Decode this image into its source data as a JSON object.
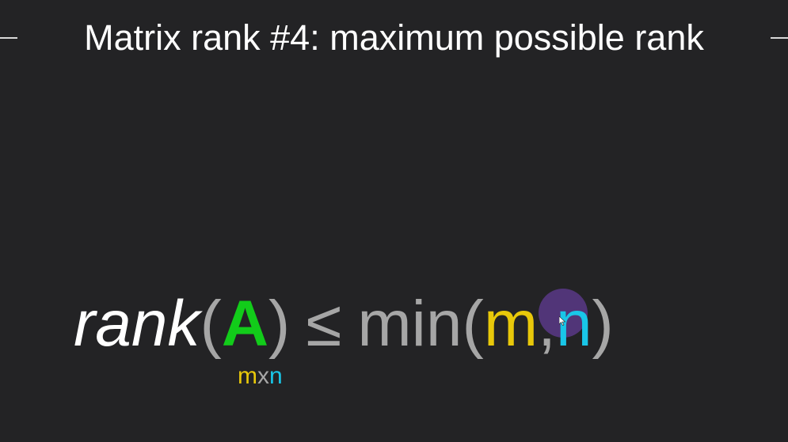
{
  "slide": {
    "title": "Matrix rank #4: maximum possible rank",
    "formula": {
      "rank_word": "rank",
      "open_paren": "(",
      "matrix_var": "A",
      "close_paren": ")",
      "leq": "≤",
      "min_word": "min",
      "open_paren_2": "(",
      "m": "m",
      "comma": ",",
      "n": "n",
      "close_paren_2": ")"
    },
    "subscript": {
      "m": "m",
      "x": "x",
      "n": "n"
    }
  },
  "colors": {
    "background": "#232325",
    "matrix_var": "#12cc1a",
    "m": "#e8c80a",
    "n": "#19c6e8",
    "gray": "#a6a6a6",
    "white": "#ffffff"
  },
  "cursor": {
    "icon": "pointer-cursor-icon"
  }
}
